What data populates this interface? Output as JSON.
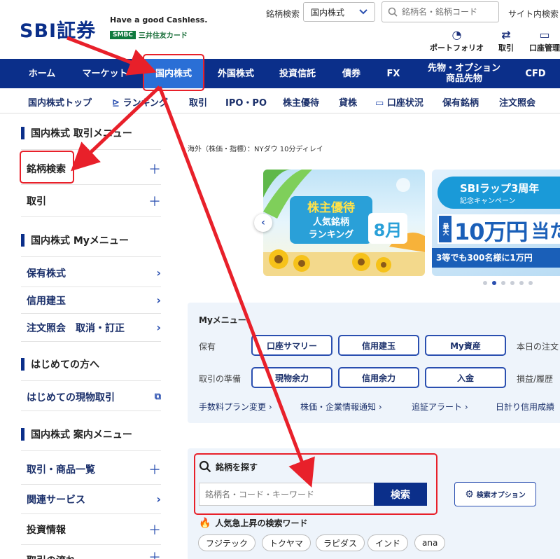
{
  "header": {
    "logo": "SBI証券",
    "tagline": "Have a good Cashless.",
    "smbc_badge": "SMBC",
    "smbc_card": "三井住友カード",
    "brand_search_label": "銘柄検索",
    "market_select_value": "国内株式",
    "search_placeholder": "銘柄名・銘柄コード",
    "site_search_label": "サイト内検索",
    "icons": [
      {
        "label": "ポートフォリオ"
      },
      {
        "label": "取引"
      },
      {
        "label": "口座管理"
      }
    ]
  },
  "main_nav": [
    {
      "label": "ホーム"
    },
    {
      "label": "マーケット"
    },
    {
      "label": "国内株式"
    },
    {
      "label": "外国株式"
    },
    {
      "label": "投資信託"
    },
    {
      "label": "債券"
    },
    {
      "label": "FX"
    },
    {
      "label": "先物・オプション\n商品先物"
    },
    {
      "label": "CFD"
    }
  ],
  "sub_nav": [
    {
      "label": "国内株式トップ"
    },
    {
      "label": "ランキング"
    },
    {
      "label": "取引"
    },
    {
      "label": "IPO・PO"
    },
    {
      "label": "株主優待"
    },
    {
      "label": "貸株"
    },
    {
      "label": "口座状況"
    },
    {
      "label": "保有銘柄"
    },
    {
      "label": "注文照会"
    }
  ],
  "sidebar": {
    "trade_menu_title": "国内株式 取引メニュー",
    "trade_items": [
      {
        "label": "銘柄検索"
      },
      {
        "label": "取引"
      }
    ],
    "my_menu_title": "国内株式 Myメニュー",
    "my_items": [
      {
        "label": "保有株式"
      },
      {
        "label": "信用建玉"
      },
      {
        "label": "注文照会　取消・訂正"
      }
    ],
    "beginner_title": "はじめての方へ",
    "beginner_items": [
      {
        "label": "はじめての現物取引"
      }
    ],
    "guide_title": "国内株式 案内メニュー",
    "guide_items": [
      {
        "label": "取引・商品一覧"
      },
      {
        "label": "関連サービス"
      },
      {
        "label": "投資情報"
      },
      {
        "label": "取引の流れ"
      }
    ]
  },
  "content": {
    "delay_notice": "海外（株価・指標）：NYダウ 10分ディレイ",
    "banner1": {
      "heading": "株主優待",
      "sub1": "人気銘柄",
      "sub2": "ランキング",
      "month": "8月"
    },
    "banner2": {
      "heading": "SBIラップ3周年",
      "sub": "記念キャンペーン",
      "max": "最大",
      "amount": "10万円",
      "tail": "当た",
      "footer": "3等でも300名様に1万円"
    },
    "my_menu": {
      "title": "Myメニュー",
      "row1_label": "保有",
      "row1_buttons": [
        {
          "label": "口座サマリー"
        },
        {
          "label": "信用建玉"
        },
        {
          "label": "My資産"
        }
      ],
      "row1_extra": "本日の注文",
      "row2_label": "取引の準備",
      "row2_buttons": [
        {
          "label": "現物余力"
        },
        {
          "label": "信用余力"
        },
        {
          "label": "入金"
        }
      ],
      "row2_extra": "損益/履歴",
      "links": [
        {
          "label": "手数料プラン変更"
        },
        {
          "label": "株価・企業情報通知"
        },
        {
          "label": "追証アラート"
        },
        {
          "label": "日計り信用成績"
        }
      ]
    },
    "stock_search": {
      "title": "銘柄を探す",
      "placeholder": "銘柄名・コード・キーワード",
      "button": "検索",
      "options_button": "検索オプション",
      "trending_title": "人気急上昇の検索ワード",
      "tags": [
        {
          "label": "フジテック"
        },
        {
          "label": "トクヤマ"
        },
        {
          "label": "ラピダス"
        },
        {
          "label": "インド"
        },
        {
          "label": "ana"
        }
      ]
    }
  }
}
